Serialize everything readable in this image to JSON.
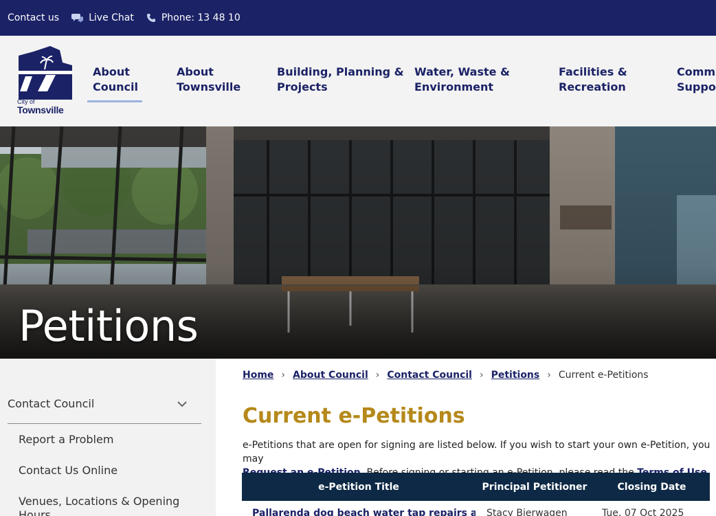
{
  "utility": {
    "contact": "Contact us",
    "chat": "Live Chat",
    "phone": "Phone: 13 48 10"
  },
  "logo": {
    "city_of": "City of",
    "city_name": "Townsville"
  },
  "nav": [
    {
      "label": "About\nCouncil"
    },
    {
      "label": "About\nTownsville"
    },
    {
      "label": "Building, Planning &\nProjects"
    },
    {
      "label": "Water, Waste &\nEnvironment"
    },
    {
      "label": "Facilities &\nRecreation"
    },
    {
      "label": "Commu\nSuppor"
    }
  ],
  "hero": {
    "title": "Petitions"
  },
  "sidebar": {
    "heading": "Contact Council",
    "links": [
      {
        "label": "Report a Problem"
      },
      {
        "label": "Contact Us Online"
      },
      {
        "label": "Venues, Locations & Opening Hours"
      }
    ]
  },
  "breadcrumb": {
    "items": [
      "Home",
      "About Council",
      "Contact Council",
      "Petitions"
    ],
    "current": "Current e-Petitions"
  },
  "page": {
    "title": "Current e-Petitions",
    "intro_1": "e-Petitions that are open for signing are listed below. If you wish to start your own e-Petition, you may",
    "request_link": "Request an e-Petition",
    "intro_2": ". Before signing or starting an e-Petition, please read the ",
    "terms_link": "Terms of Use",
    "intro_3": "."
  },
  "table": {
    "headers": [
      "e-Petition Title",
      "Principal Petitioner",
      "Closing Date"
    ],
    "rows": [
      {
        "title": "Pallarenda dog beach water tap repairs and",
        "petitioner": "Stacy Bierwagen",
        "closing": "Tue, 07 Oct 2025"
      }
    ]
  },
  "colors": {
    "navy": "#1b2266",
    "gold": "#b5891a",
    "table_header": "#0d2945"
  }
}
